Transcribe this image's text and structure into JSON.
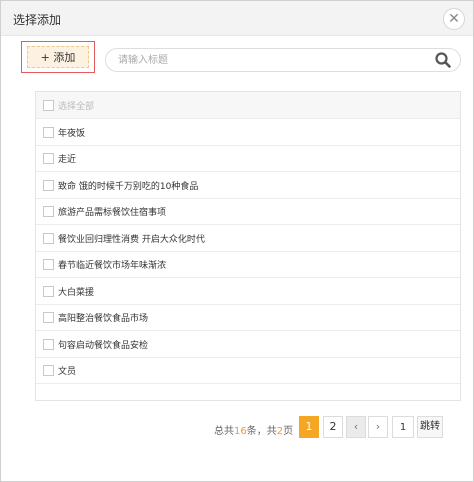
{
  "dialog": {
    "title": "选择添加",
    "close_icon": "close-icon"
  },
  "toolbar": {
    "add_label": "+ 添加"
  },
  "search": {
    "placeholder": "请输入标题",
    "value": "",
    "icon": "search-icon"
  },
  "list": {
    "select_all_label": "选择全部",
    "items": [
      {
        "label": "年夜饭"
      },
      {
        "label": "走近"
      },
      {
        "label": "致命 饿的时候千万别吃的10种食品"
      },
      {
        "label": "旅游产品需标餐饮住宿事项"
      },
      {
        "label": "餐饮业回归理性消费 开启大众化时代"
      },
      {
        "label": "春节临近餐饮市场年味渐浓"
      },
      {
        "label": "大白菜援"
      },
      {
        "label": "高阳整治餐饮食品市场"
      },
      {
        "label": "句容启动餐饮食品安检"
      },
      {
        "label": "文员"
      }
    ]
  },
  "pagination": {
    "summary_prefix": "总共",
    "total_items": "16",
    "summary_mid": "条，共",
    "total_pages": "2",
    "summary_suffix": "页",
    "pages": [
      "1",
      "2"
    ],
    "current_page": "1",
    "prev_icon": "chevron-left-icon",
    "next_icon": "chevron-right-icon",
    "jump_value": "1",
    "jump_label": "跳转"
  },
  "colors": {
    "accent": "#f5a623",
    "add_border": "#e35b5b"
  }
}
